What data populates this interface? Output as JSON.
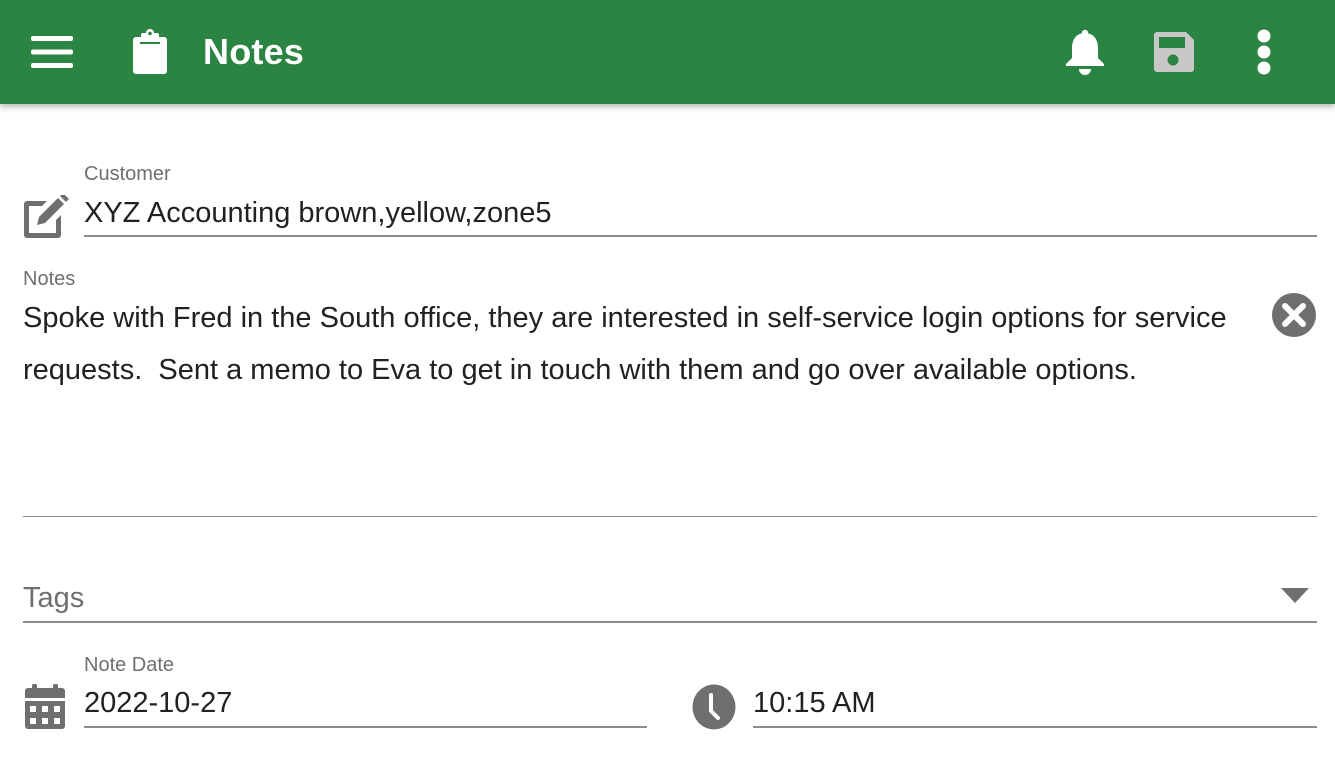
{
  "appbar": {
    "title": "Notes",
    "color": "#2b8441",
    "icons": {
      "menu": "hamburger-menu-icon",
      "app": "clipboard-icon",
      "notifications": "bell-icon",
      "save": "floppy-disk-save-icon",
      "more": "more-vert-icon"
    },
    "save_disabled": true
  },
  "form": {
    "customer": {
      "label": "Customer",
      "value": "XYZ Accounting brown,yellow,zone5",
      "icon": "edit-icon"
    },
    "notes": {
      "label": "Notes",
      "value": "Spoke with Fred in the South office, they are interested in self-service login options for service requests.  Sent a memo to Eva to get in touch with them and go over available options.",
      "clear_icon": "clear-circle-icon"
    },
    "tags": {
      "placeholder": "Tags",
      "icon": "dropdown-arrow-icon"
    },
    "note_date": {
      "label": "Note Date",
      "value": "2022-10-27",
      "icon": "calendar-icon"
    },
    "note_time": {
      "value": "10:15 AM",
      "icon": "clock-icon"
    }
  }
}
